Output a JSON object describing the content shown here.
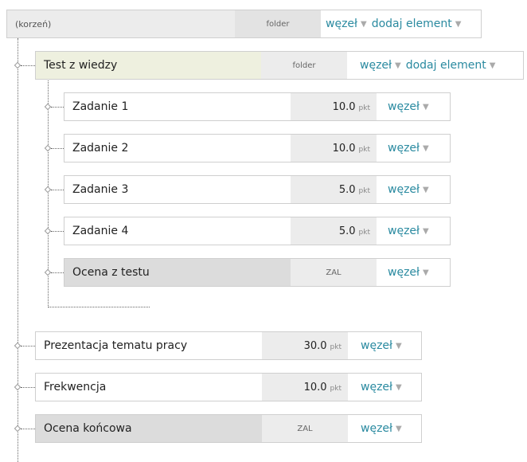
{
  "root": {
    "name": "(korzeń)",
    "type": "folder",
    "node_menu": "węzeł",
    "add_menu": "dodaj element"
  },
  "test": {
    "name": "Test z wiedzy",
    "type": "folder",
    "node_menu": "węzeł",
    "add_menu": "dodaj element"
  },
  "tasks": [
    {
      "name": "Zadanie 1",
      "points": "10.0",
      "unit": "pkt",
      "node_menu": "węzeł"
    },
    {
      "name": "Zadanie 2",
      "points": "10.0",
      "unit": "pkt",
      "node_menu": "węzeł"
    },
    {
      "name": "Zadanie 3",
      "points": "5.0",
      "unit": "pkt",
      "node_menu": "węzeł"
    },
    {
      "name": "Zadanie 4",
      "points": "5.0",
      "unit": "pkt",
      "node_menu": "węzeł"
    }
  ],
  "test_grade": {
    "name": "Ocena z testu",
    "type": "ZAL",
    "node_menu": "węzeł"
  },
  "items": [
    {
      "name": "Prezentacja tematu pracy",
      "points": "30.0",
      "unit": "pkt",
      "node_menu": "węzeł"
    },
    {
      "name": "Frekwencja",
      "points": "10.0",
      "unit": "pkt",
      "node_menu": "węzeł"
    }
  ],
  "final_grade": {
    "name": "Ocena końcowa",
    "type": "ZAL",
    "node_menu": "węzeł"
  },
  "colors": {
    "link": "#2a8aa0",
    "folder_highlight": "#eef0df",
    "grade_bg": "#dcdcdc",
    "type_bg": "#ececec"
  },
  "icons": {
    "caret": "caret-down-icon",
    "connector": "tree-connector-diamond-icon"
  }
}
